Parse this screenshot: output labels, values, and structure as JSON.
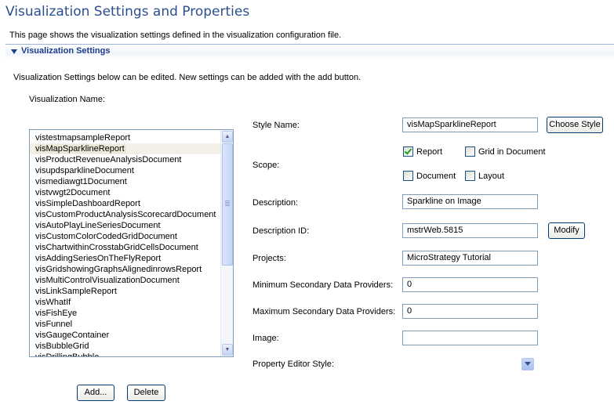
{
  "page": {
    "title": "Visualization Settings and Properties",
    "description": "This page shows the visualization settings defined in the visualization configuration file."
  },
  "section": {
    "title": "Visualization Settings",
    "description": "Visualization Settings below can be edited. New settings can be added with the add button.",
    "vis_name_label": "Visualization Name:"
  },
  "list": {
    "selected_index": 1,
    "items": [
      "vistestmapsampleReport",
      "visMapSparklineReport",
      "visProductRevenueAnalysisDocument",
      "visupdsparklineDocument",
      "vismediawgt1Document",
      "vistvwgt2Document",
      "visSimpleDashboardReport",
      "visCustomProductAnalysisScorecardDocument",
      "visAutoPlayLineSeriesDocument",
      "visCustomColorCodedGridDocument",
      "visChartwithinCrosstabGridCellsDocument",
      "visAddingSeriesOnTheFlyReport",
      "visGridshowingGraphsAlignedinrowsReport",
      "visMultiControlVisualizationDocument",
      "visLinkSampleReport",
      "visWhatIf",
      "visFishEye",
      "visFunnel",
      "visGaugeContainer",
      "visBubbleGrid",
      "visDrillingBubble"
    ]
  },
  "buttons": {
    "add": "Add...",
    "delete": "Delete",
    "choose_style": "Choose Style",
    "modify": "Modify"
  },
  "form": {
    "style_name_label": "Style Name:",
    "style_name_value": "visMapSparklineReport",
    "scope_label": "Scope:",
    "scope_report": "Report",
    "scope_grid_in_document": "Grid in Document",
    "scope_document": "Document",
    "scope_layout": "Layout",
    "description_label": "Description:",
    "description_value": "Sparkline on Image",
    "description_id_label": "Description ID:",
    "description_id_value": "mstrWeb.5815",
    "projects_label": "Projects:",
    "projects_value": "MicroStrategy Tutorial",
    "min_secondary_label": "Minimum Secondary Data Providers:",
    "min_secondary_value": "0",
    "max_secondary_label": "Maximum Secondary Data Providers:",
    "max_secondary_value": "0",
    "image_label": "Image:",
    "image_value": "",
    "property_editor_label": "Property Editor Style:"
  },
  "colors": {
    "title": "#2b4f8e",
    "section_title": "#1c3c8c",
    "field_border": "#7f9db9",
    "button_border": "#003c74"
  }
}
